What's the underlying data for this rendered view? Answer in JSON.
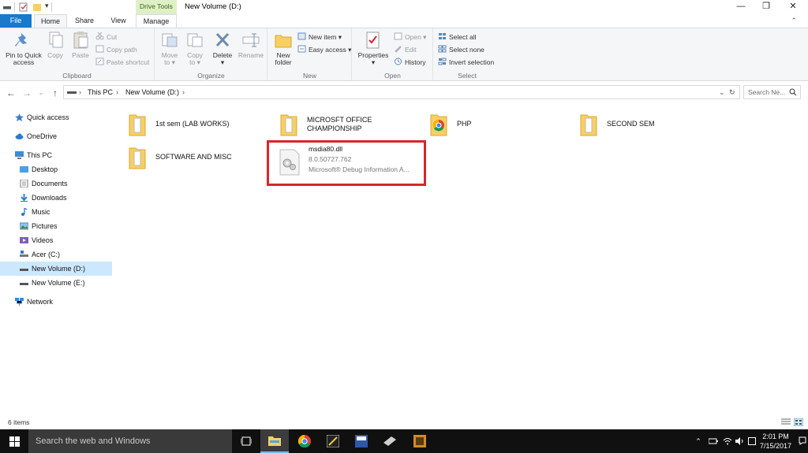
{
  "titlebar": {
    "context_tab": "Drive Tools",
    "window_title": "New Volume (D:)",
    "minimize": "—",
    "maximize": "❐",
    "close": "✕"
  },
  "tabs": {
    "file": "File",
    "home": "Home",
    "share": "Share",
    "view": "View",
    "manage": "Manage"
  },
  "ribbon": {
    "clipboard": {
      "group_label": "Clipboard",
      "pin_label_1": "Pin to Quick",
      "pin_label_2": "access",
      "copy": "Copy",
      "paste": "Paste",
      "cut": "Cut",
      "copy_path": "Copy path",
      "paste_shortcut": "Paste shortcut"
    },
    "organize": {
      "group_label": "Organize",
      "move_to_1": "Move",
      "move_to_2": "to ▾",
      "copy_to_1": "Copy",
      "copy_to_2": "to ▾",
      "delete_1": "Delete",
      "delete_2": "▾",
      "rename": "Rename"
    },
    "new": {
      "group_label": "New",
      "new_folder_1": "New",
      "new_folder_2": "folder",
      "new_item": "New item ▾",
      "easy_access": "Easy access ▾"
    },
    "open": {
      "group_label": "Open",
      "properties_1": "Properties",
      "properties_2": "▾",
      "open": "Open ▾",
      "edit": "Edit",
      "history": "History"
    },
    "select": {
      "group_label": "Select",
      "select_all": "Select all",
      "select_none": "Select none",
      "invert_selection": "Invert selection"
    }
  },
  "address": {
    "crumb_1": "This PC",
    "crumb_2": "New Volume (D:)",
    "search_placeholder": "Search Ne..."
  },
  "nav": {
    "quick_access": "Quick access",
    "onedrive": "OneDrive",
    "this_pc": "This PC",
    "desktop": "Desktop",
    "documents": "Documents",
    "downloads": "Downloads",
    "music": "Music",
    "pictures": "Pictures",
    "videos": "Videos",
    "acer_c": "Acer (C:)",
    "new_volume_d": "New Volume (D:)",
    "new_volume_e": "New Volume (E:)",
    "network": "Network"
  },
  "content": {
    "items": [
      {
        "name_1": "1st sem (LAB WORKS)",
        "name_2": ""
      },
      {
        "name_1": "MICROSFT OFFICE",
        "name_2": "CHAMPIONSHIP"
      },
      {
        "name_1": "PHP",
        "name_2": ""
      },
      {
        "name_1": "SECOND SEM",
        "name_2": ""
      },
      {
        "name_1": "SOFTWARE AND MISC",
        "name_2": ""
      }
    ],
    "dll": {
      "name": "msdia80.dll",
      "version": "8.0.50727.762",
      "description": "Microsoft® Debug Information A..."
    }
  },
  "status": {
    "item_count": "6 items"
  },
  "taskbar": {
    "search_placeholder": "Search the web and Windows",
    "time": "2:01 PM",
    "date": "7/15/2017"
  },
  "colors": {
    "accent": "#1979ca",
    "selection": "#cce8ff",
    "highlight_box": "#d8262b",
    "context_tab_bg": "#dff0c6"
  }
}
